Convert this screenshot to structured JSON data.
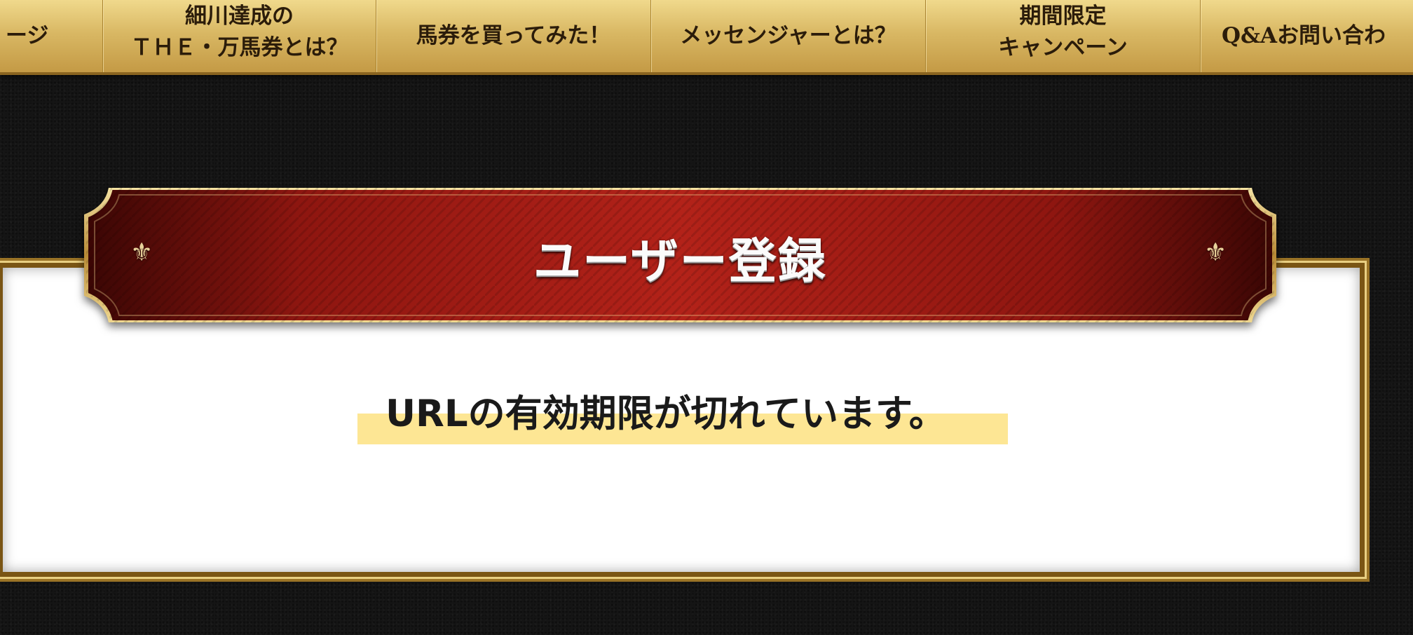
{
  "nav": {
    "items": [
      {
        "lines": [
          "ージ"
        ]
      },
      {
        "lines": [
          "細川達成の",
          "ＴＨＥ・万馬券とは？"
        ]
      },
      {
        "lines": [
          "馬券を買ってみた！"
        ]
      },
      {
        "lines": [
          "メッセンジャーとは？"
        ]
      },
      {
        "lines": [
          "期間限定",
          "キャンペーン"
        ]
      },
      {
        "lines": [
          "Q&Aお問い合わ"
        ]
      }
    ]
  },
  "banner": {
    "title": "ユーザー登録",
    "ornament": "⚜"
  },
  "message": {
    "text": "URLの有効期限が切れています。"
  },
  "colors": {
    "nav_gold": "#d9b864",
    "banner_red": "#9e1a12",
    "frame_gold": "#9a7326",
    "highlight_yellow": "#fde694"
  }
}
